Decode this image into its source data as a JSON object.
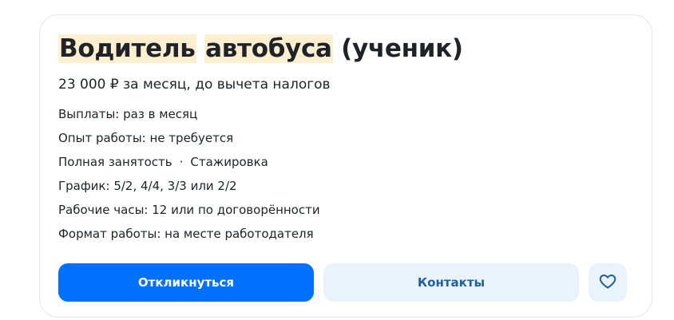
{
  "vacancy": {
    "title_words": [
      "Водитель",
      "автобуса"
    ],
    "title_suffix": "(ученик)",
    "salary": "23 000 ₽ за месяц, до вычета налогов",
    "payments": "Выплаты: раз в месяц",
    "experience": "Опыт работы: не требуется",
    "employment": "Полная занятость",
    "employment_extra": "Стажировка",
    "separator": "·",
    "schedule": "График: 5/2, 4/4, 3/3 или 2/2",
    "hours": "Рабочие часы: 12 или по договорённости",
    "work_format": "Формат работы: на месте работодателя"
  },
  "actions": {
    "apply_label": "Откликнуться",
    "contacts_label": "Контакты",
    "favorite_icon": "heart-icon"
  },
  "colors": {
    "primary": "#0070ff",
    "secondary_bg": "#eaf2fb",
    "highlight": "#fcefcf"
  }
}
